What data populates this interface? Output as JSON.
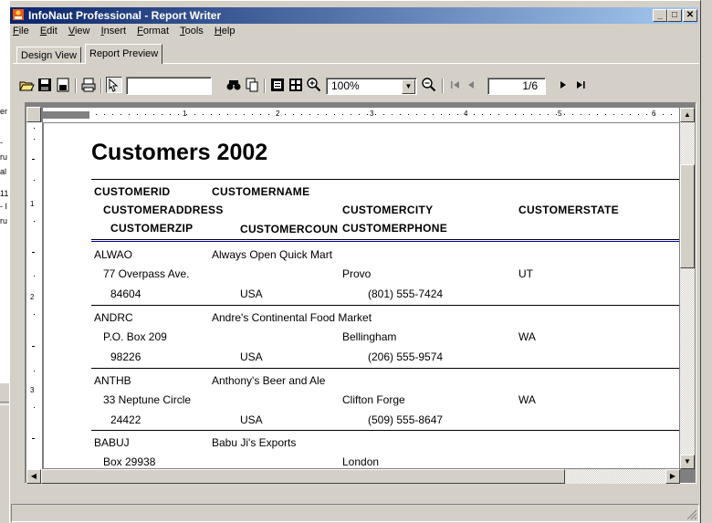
{
  "window": {
    "title": "InfoNaut Professional - Report Writer"
  },
  "left_panel_fragments": [
    "er",
    "-",
    "ru",
    "al",
    "11",
    "- I",
    "ru"
  ],
  "menu": [
    "File",
    "Edit",
    "View",
    "Insert",
    "Format",
    "Tools",
    "Help"
  ],
  "tabs": [
    "Design View",
    "Report Preview"
  ],
  "toolbar": {
    "search_value": "",
    "zoom": "100%",
    "page": "1/6",
    "icons": [
      "open-icon",
      "save-icon",
      "save-as-icon",
      "print-icon",
      "select-icon",
      "find-icon",
      "copy-icon",
      "single-page-icon",
      "multi-page-icon",
      "zoom-in-icon",
      "zoom-out-icon",
      "first-page-icon",
      "previous-page-icon",
      "next-page-icon",
      "last-page-icon"
    ]
  },
  "ruler": {
    "h_marks": [
      "1",
      "2",
      "3",
      "4",
      "5",
      "6"
    ],
    "v_marks": [
      "1",
      "2",
      "3"
    ]
  },
  "report": {
    "title": "Customers 2002",
    "headers": {
      "id": "CUSTOMERID",
      "name": "CUSTOMERNAME",
      "address": "CUSTOMERADDRESS",
      "city": "CUSTOMERCITY",
      "state": "CUSTOMERSTATE",
      "zip": "CUSTOMERZIP",
      "country": "CUSTOMERCOUN",
      "phone": "CUSTOMERPHONE"
    },
    "records": [
      {
        "id": "ALWAO",
        "name": "Always Open Quick Mart",
        "address": "77 Overpass Ave.",
        "city": "Provo",
        "state": "UT",
        "zip": "84604",
        "country": "USA",
        "phone": "(801) 555-7424"
      },
      {
        "id": "ANDRC",
        "name": "Andre's Continental Food Market",
        "address": "P.O. Box 209",
        "city": "Bellingham",
        "state": "WA",
        "zip": "98226",
        "country": "USA",
        "phone": "(206) 555-9574"
      },
      {
        "id": "ANTHB",
        "name": "Anthony's Beer and Ale",
        "address": "33 Neptune Circle",
        "city": "Clifton Forge",
        "state": "WA",
        "zip": "24422",
        "country": "USA",
        "phone": "(509) 555-8647"
      },
      {
        "id": "BABUJ",
        "name": "Babu Ji's Exports",
        "address": "Box 29938",
        "city": "London",
        "state": "",
        "zip": "",
        "country": "",
        "phone": ""
      }
    ]
  }
}
